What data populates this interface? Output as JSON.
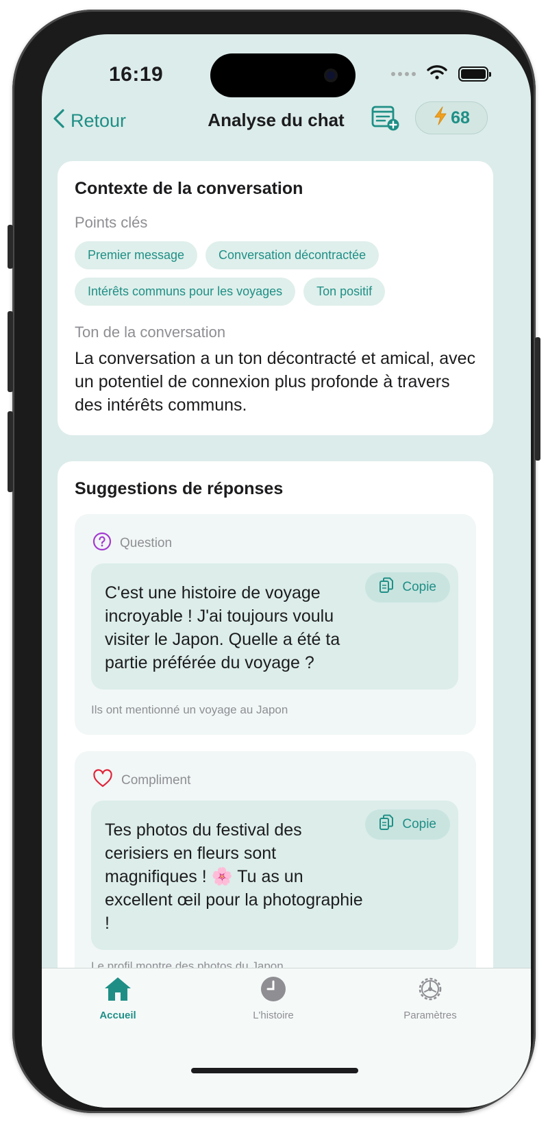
{
  "status": {
    "time": "16:19"
  },
  "nav": {
    "back_label": "Retour",
    "title": "Analyse du chat",
    "credits": "68"
  },
  "context": {
    "title": "Contexte de la conversation",
    "key_points_label": "Points clés",
    "key_points": [
      "Premier message",
      "Conversation décontractée",
      "Intérêts communs pour les voyages",
      "Ton positif"
    ],
    "tone_label": "Ton de la conversation",
    "tone_text": "La conversation a un ton décontracté et amical, avec un potentiel de connexion plus profonde à travers des intérêts communs."
  },
  "suggestions": {
    "title": "Suggestions de réponses",
    "items": [
      {
        "type": "Question",
        "icon": "question-circle-icon",
        "text": "C'est une histoire de voyage incroyable ! J'ai toujours voulu visiter le Japon. Quelle a été ta partie préférée du voyage ?",
        "copy_label": "Copie",
        "reason": "Ils ont mentionné un voyage au Japon"
      },
      {
        "type": "Compliment",
        "icon": "heart-icon",
        "text": "Tes photos du festival des cerisiers en fleurs sont magnifiques ! 🌸 Tu as un excellent œil pour la photographie !",
        "copy_label": "Copie",
        "reason": "Le profil montre des photos du Japon"
      }
    ]
  },
  "tabs": [
    {
      "label": "Accueil",
      "icon": "home-icon",
      "active": true
    },
    {
      "label": "L'histoire",
      "icon": "clock-icon",
      "active": false
    },
    {
      "label": "Paramètres",
      "icon": "gear-icon",
      "active": false
    }
  ],
  "colors": {
    "accent": "#1f8f86",
    "background": "#dcecea",
    "question": "#a43ad1",
    "heart": "#e0243a",
    "bolt": "#f0a020"
  }
}
